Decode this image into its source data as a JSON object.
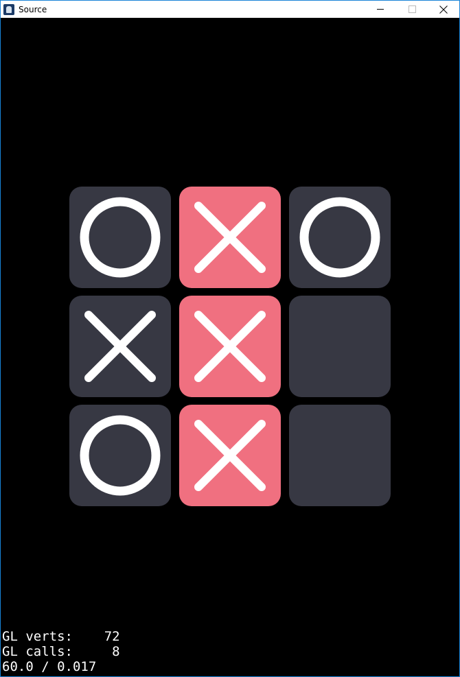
{
  "window": {
    "title": "Source",
    "icon": "app-icon"
  },
  "board": {
    "empty_color": "#373843",
    "win_color": "#f07080",
    "mark_color": "#ffffff",
    "cells": [
      {
        "row": 0,
        "col": 0,
        "mark": "O",
        "highlight": false
      },
      {
        "row": 0,
        "col": 1,
        "mark": "X",
        "highlight": true
      },
      {
        "row": 0,
        "col": 2,
        "mark": "O",
        "highlight": false
      },
      {
        "row": 1,
        "col": 0,
        "mark": "X",
        "highlight": false
      },
      {
        "row": 1,
        "col": 1,
        "mark": "X",
        "highlight": true
      },
      {
        "row": 1,
        "col": 2,
        "mark": "",
        "highlight": false
      },
      {
        "row": 2,
        "col": 0,
        "mark": "O",
        "highlight": false
      },
      {
        "row": 2,
        "col": 1,
        "mark": "X",
        "highlight": true
      },
      {
        "row": 2,
        "col": 2,
        "mark": "",
        "highlight": false
      }
    ]
  },
  "debug": {
    "verts_line": "GL verts:    72",
    "calls_line": "GL calls:     8",
    "fps_line": "60.0 / 0.017"
  }
}
